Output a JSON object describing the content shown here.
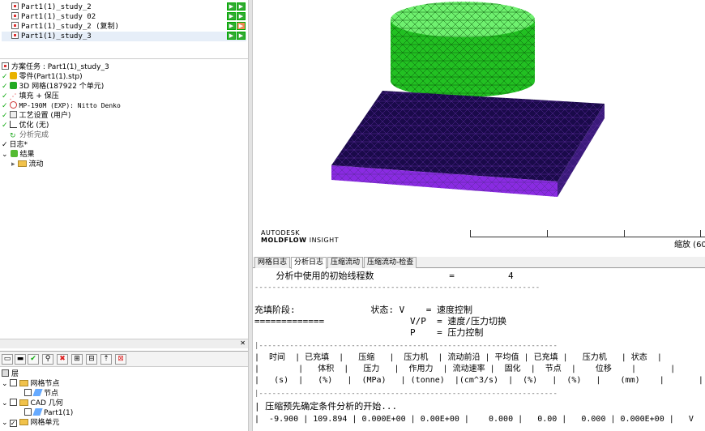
{
  "studies": [
    {
      "label": "Part1(1)_study_2"
    },
    {
      "label": "Part1(1)_study 02"
    },
    {
      "label": "Part1(1)_study_2 (复制)"
    },
    {
      "label": "Part1(1)_study_3"
    }
  ],
  "task_tree": {
    "header": "方案任务 : Part1(1)_study_3",
    "items": [
      "零件(Part1(1).stp)",
      "3D 网格(187922 个单元)",
      "填充 + 保压",
      "MP-190M (EXP): Nitto Denko",
      "工艺设置 (用户)",
      "优化 (无)",
      "分析完成",
      "日志*",
      "结果",
      "流动"
    ]
  },
  "layers": {
    "root": "层",
    "items": [
      "网格节点",
      "节点",
      "CAD 几何",
      "Part1(1)",
      "网格单元"
    ]
  },
  "viewport": {
    "brand_line1": "AUTODESK",
    "brand_line2": "MOLDFLOW",
    "brand_line2b": "INSIGHT",
    "zoom_label": "缩放 (60"
  },
  "log_tabs": [
    "网格日志",
    "分析日志",
    "压缩流动",
    "压缩流动-检查"
  ],
  "log_lines": [
    "    分析中使用的初始线程数              =          4",
    "-----------------------------------------------------------------",
    "",
    "充填阶段:              状态: V    = 速度控制",
    "=============                V/P  = 速度/压力切换",
    "                             P    = 压力控制",
    "|--------------------------------------------------------------------",
    "|  时间  | 已充填  |   压缩   |  压力机  | 流动前沿 | 平均值 | 已充填 |   压力机   | 状态  |",
    "|        |   体积  |   压力   |  作用力  | 流动速率 |  固化  |  节点  |    位移    |       |",
    "|   (s)  |   (%)   |  (MPa)   | (tonne)  |(cm^3/s)  |  (%)   |  (%)   |    (mm)    |       |",
    "|--------------------------------------------------------------------",
    "| 压缩预先确定条件分析的开始...",
    "|  -9.900 | 109.894 | 0.000E+00 | 0.00E+00 |    0.000 |   0.00 |   0.000 | 0.000E+00 |   V   |"
  ]
}
